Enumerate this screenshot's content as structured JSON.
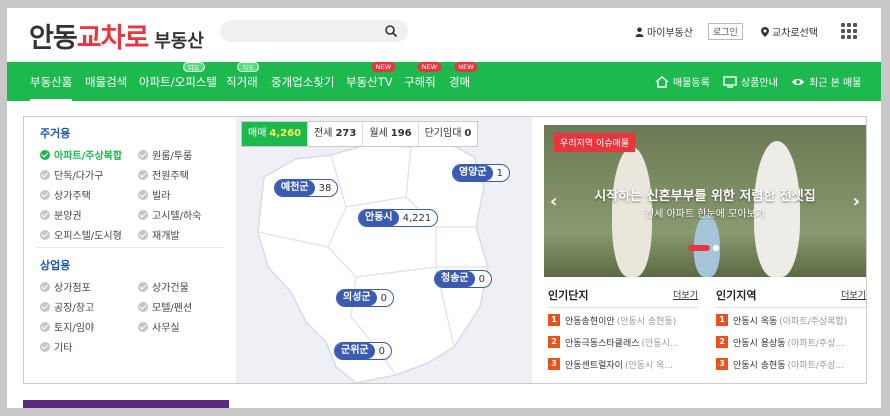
{
  "header": {
    "logo_part1": "안동",
    "logo_part2": "교차로",
    "logo_part3": "부동산",
    "search_placeholder": "",
    "my_realty": "마이부동산",
    "login": "로그인",
    "region_select": "교차로선택"
  },
  "nav": {
    "items": [
      {
        "label": "부동산홈",
        "badge": ""
      },
      {
        "label": "매물검색",
        "badge": ""
      },
      {
        "label": "아파트/오피스텔",
        "badge": "지도"
      },
      {
        "label": "직거래",
        "badge": "지도"
      },
      {
        "label": "중개업소찾기",
        "badge": ""
      },
      {
        "label": "부동산TV",
        "badge": "NEW"
      },
      {
        "label": "구해줘",
        "badge": "NEW"
      },
      {
        "label": "경매",
        "badge": "NEW"
      }
    ],
    "register": "매물등록",
    "product_info": "상품안내",
    "recent": "최근 본 매물"
  },
  "categories": {
    "residential_title": "주거용",
    "residential": [
      {
        "label": "아파트/주상복합",
        "selected": true
      },
      {
        "label": "원룸/투룸",
        "selected": false
      },
      {
        "label": "단독/다가구",
        "selected": false
      },
      {
        "label": "전원주택",
        "selected": false
      },
      {
        "label": "상가주택",
        "selected": false
      },
      {
        "label": "빌라",
        "selected": false
      },
      {
        "label": "분양권",
        "selected": false
      },
      {
        "label": "고시텔/하숙",
        "selected": false
      },
      {
        "label": "오피스텔/도시형",
        "selected": false
      },
      {
        "label": "재개발",
        "selected": false
      }
    ],
    "commercial_title": "상업용",
    "commercial": [
      {
        "label": "상가점포",
        "selected": false
      },
      {
        "label": "상가건물",
        "selected": false
      },
      {
        "label": "공장/창고",
        "selected": false
      },
      {
        "label": "모텔/펜션",
        "selected": false
      },
      {
        "label": "토지/임야",
        "selected": false
      },
      {
        "label": "사무실",
        "selected": false
      },
      {
        "label": "기타",
        "selected": false
      }
    ]
  },
  "map": {
    "tabs": [
      {
        "label": "매매",
        "count": "4,260",
        "active": true
      },
      {
        "label": "전세",
        "count": "273",
        "active": false
      },
      {
        "label": "월세",
        "count": "196",
        "active": false
      },
      {
        "label": "단기임대",
        "count": "0",
        "active": false
      }
    ],
    "regions": [
      {
        "name": "예천군",
        "count": "38"
      },
      {
        "name": "영양군",
        "count": "1"
      },
      {
        "name": "안동시",
        "count": "4,221"
      },
      {
        "name": "청송군",
        "count": "0"
      },
      {
        "name": "의성군",
        "count": "0"
      },
      {
        "name": "군위군",
        "count": "0"
      }
    ]
  },
  "banner": {
    "tag": "우리지역 이슈매물",
    "title": "시작하는 신혼부부를 위한 저렴한 전셋집",
    "subtitle": "전세 아파트 한눈에 모아보기"
  },
  "popular_complex": {
    "title": "인기단지",
    "more": "더보기",
    "items": [
      {
        "rank": "1",
        "name": "안동송현이안",
        "loc": "(안동시 송현동)"
      },
      {
        "rank": "2",
        "name": "안동극동스타클래스",
        "loc": "(안동시..."
      },
      {
        "rank": "3",
        "name": "안동센트럴자이",
        "loc": "(안동시 옥..."
      }
    ]
  },
  "popular_region": {
    "title": "인기지역",
    "more": "더보기",
    "items": [
      {
        "rank": "1",
        "name": "안동시 옥동",
        "loc": "(아파트/주상복합)"
      },
      {
        "rank": "2",
        "name": "안동시 용상동",
        "loc": "(아파트/주상..."
      },
      {
        "rank": "3",
        "name": "안동시 송현동",
        "loc": "(아파트/주상..."
      }
    ]
  },
  "colors": {
    "brand_green": "#1db84e",
    "brand_red": "#e8363f",
    "map_marker": "#3b5bb0"
  }
}
